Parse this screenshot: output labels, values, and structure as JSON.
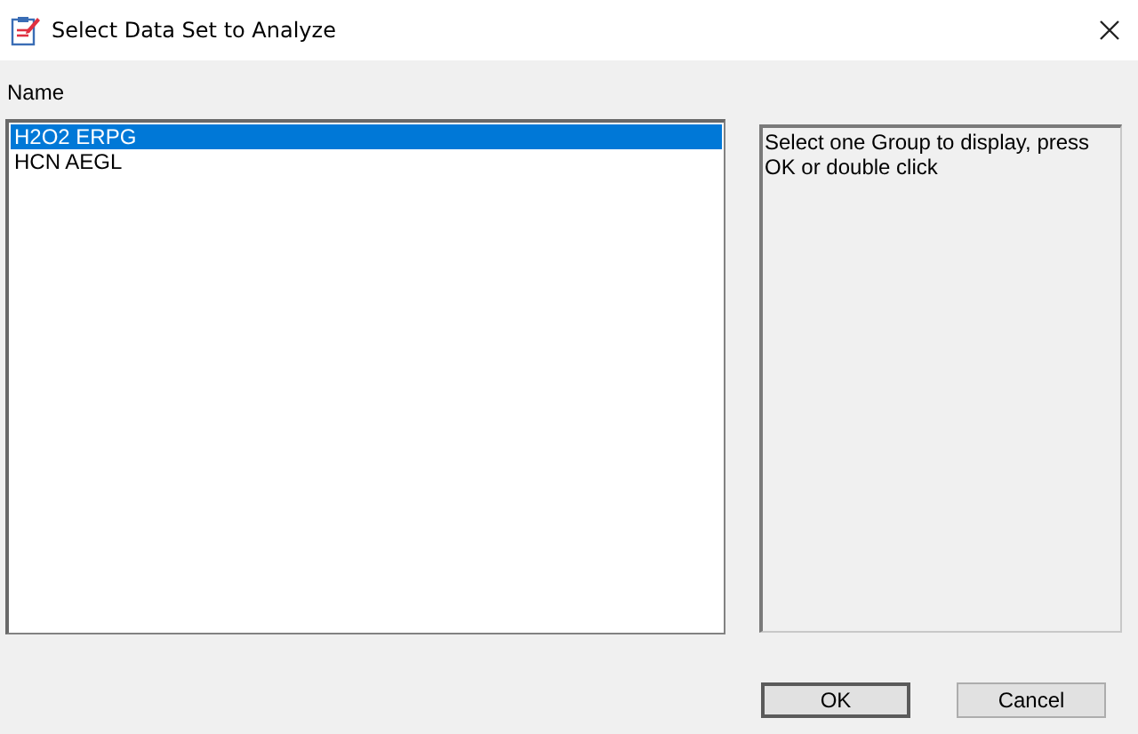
{
  "window": {
    "title": "Select Data Set to Analyze"
  },
  "list": {
    "header": "Name",
    "items": [
      {
        "label": "H2O2 ERPG",
        "selected": true
      },
      {
        "label": "HCN AEGL",
        "selected": false
      }
    ]
  },
  "help_text": "Select one Group to display, press OK or double click",
  "buttons": [
    {
      "label": "OK",
      "default": true
    },
    {
      "label": "Cancel",
      "default": false
    }
  ]
}
